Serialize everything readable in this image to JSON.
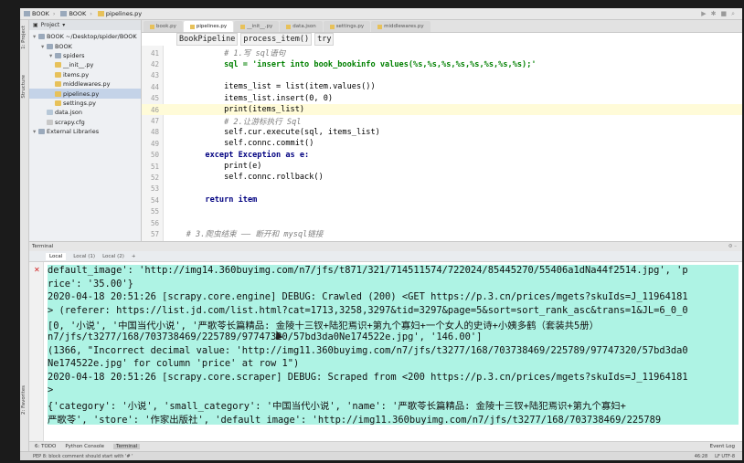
{
  "titlebar": {
    "crumbs": [
      "BOOK",
      "BOOK",
      "pipelines.py"
    ],
    "icons": [
      "run-icon",
      "debug-icon",
      "stop-icon",
      "search-icon"
    ]
  },
  "left_tools": {
    "project_label": "1: Project",
    "structure_label": "Structure",
    "favorites_label": "2: Favorites"
  },
  "project": {
    "header": "Project",
    "items": [
      {
        "label": "BOOK  ~/Desktop/spider/BOOK",
        "indent": 0,
        "type": "folder"
      },
      {
        "label": "BOOK",
        "indent": 1,
        "type": "folder"
      },
      {
        "label": "spiders",
        "indent": 2,
        "type": "folder"
      },
      {
        "label": "__init__.py",
        "indent": 2,
        "type": "py"
      },
      {
        "label": "items.py",
        "indent": 2,
        "type": "py"
      },
      {
        "label": "middlewares.py",
        "indent": 2,
        "type": "py"
      },
      {
        "label": "pipelines.py",
        "indent": 2,
        "type": "py",
        "selected": true
      },
      {
        "label": "settings.py",
        "indent": 2,
        "type": "py"
      },
      {
        "label": "data.json",
        "indent": 1,
        "type": "json"
      },
      {
        "label": "scrapy.cfg",
        "indent": 1,
        "type": "cfg"
      },
      {
        "label": "External Libraries",
        "indent": 0,
        "type": "folder"
      }
    ]
  },
  "editor": {
    "tabs": [
      {
        "label": "book.py",
        "active": false
      },
      {
        "label": "pipelines.py",
        "active": true
      },
      {
        "label": "__init__.py",
        "active": false
      },
      {
        "label": "data.json",
        "active": false
      },
      {
        "label": "settings.py",
        "active": false
      },
      {
        "label": "middlewares.py",
        "active": false
      }
    ],
    "breadcrumbs": [
      "BookPipeline",
      "process_item()",
      "try"
    ],
    "lines": [
      {
        "n": "41",
        "text": "            # 1.写 sql语句",
        "style": "comment"
      },
      {
        "n": "42",
        "text": "            sql = 'insert into book_bookinfo values(%s,%s,%s,%s,%s,%s,%s,%s);'",
        "style": "str"
      },
      {
        "n": "43",
        "text": "",
        "style": ""
      },
      {
        "n": "44",
        "text": "            items_list = list(item.values())",
        "style": ""
      },
      {
        "n": "45",
        "text": "            items_list.insert(0, 0)",
        "style": ""
      },
      {
        "n": "46",
        "text": "            print(items_list)",
        "style": "",
        "hl": true
      },
      {
        "n": "47",
        "text": "            # 2.让游标执行 Sql",
        "style": "comment"
      },
      {
        "n": "48",
        "text": "            self.cur.execute(sql, items_list)",
        "style": ""
      },
      {
        "n": "49",
        "text": "            self.connc.commit()",
        "style": ""
      },
      {
        "n": "50",
        "text": "        except Exception as e:",
        "style": "kw"
      },
      {
        "n": "51",
        "text": "            print(e)",
        "style": ""
      },
      {
        "n": "52",
        "text": "            self.connc.rollback()",
        "style": ""
      },
      {
        "n": "53",
        "text": "",
        "style": ""
      },
      {
        "n": "54",
        "text": "        return item",
        "style": "kw"
      },
      {
        "n": "55",
        "text": "",
        "style": ""
      },
      {
        "n": "56",
        "text": "",
        "style": ""
      },
      {
        "n": "57",
        "text": "    # 3.爬虫结束 —— 断开和 mysql链接",
        "style": "comment"
      }
    ]
  },
  "terminal": {
    "header": "Terminal",
    "tabs": [
      {
        "label": "Local",
        "active": true
      },
      {
        "label": "Local (1)",
        "active": false
      },
      {
        "label": "Local (2)",
        "active": false
      }
    ],
    "lines": [
      {
        "text": "default_image': 'http://img14.360buyimg.com/n7/jfs/t871/321/714511574/722024/85445270/55406a1dNa44f2514.jpg', 'p",
        "hl": true
      },
      {
        "text": "rice': '35.00'}",
        "hl": true
      },
      {
        "text": "2020-04-18 20:51:26 [scrapy.core.engine] DEBUG: Crawled (200) <GET https://p.3.cn/prices/mgets?skuIds=J_11964181",
        "hl": true
      },
      {
        "text": "> (referer: https://list.jd.com/list.html?cat=1713,3258,3297&tid=3297&page=5&sort=sort_rank_asc&trans=1&JL=6_0_0",
        "hl": true
      },
      {
        "text": "[0, '小说', '中国当代小说', '严歌苓长篇精品: 金陵十三钗+陆犯焉识+第九个寡妇+一个女人的史诗+小姨多鹤（套装共5册）",
        "hl": true
      },
      {
        "text": "n7/jfs/t3277/168/703738469/225789/97747320/57bd3da0Ne174522e.jpg', '146.00']",
        "hl": true
      },
      {
        "text": "(1366, \"Incorrect decimal value: 'http://img11.360buyimg.com/n7/jfs/t3277/168/703738469/225789/97747320/57bd3da0",
        "hl": true
      },
      {
        "text": "Ne174522e.jpg' for column 'price' at row 1\")",
        "hl": true
      },
      {
        "text": "2020-04-18 20:51:26 [scrapy.core.scraper] DEBUG: Scraped from <200 https://p.3.cn/prices/mgets?skuIds=J_11964181",
        "hl": true
      },
      {
        "text": ">",
        "hl": true
      },
      {
        "text": "{'category': '小说', 'small_category': '中国当代小说', 'name': '严歌苓长篇精品: 金陵十三钗+陆犯焉识+第九个寡妇+",
        "hl": true
      },
      {
        "text": "严歌苓', 'store': '作家出版社', 'default_image': 'http://img11.360buyimg.com/n7/jfs/t3277/168/703738469/225789",
        "hl": true
      }
    ]
  },
  "bottom_tabs": [
    {
      "label": "6: TODO",
      "active": false
    },
    {
      "label": "Python Console",
      "active": false
    },
    {
      "label": "Terminal",
      "active": true
    }
  ],
  "event_log": "Event Log",
  "status": {
    "message": "PEP 8: block comment should start with '# '",
    "position": "46:28",
    "encoding": "LF  UTF-8"
  }
}
